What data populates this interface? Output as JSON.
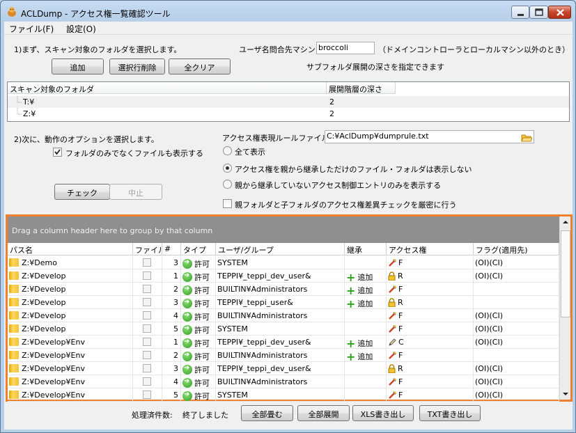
{
  "window": {
    "title": "ACLDump - アクセス権一覧確認ツール"
  },
  "menu": {
    "file": "ファイル(F)",
    "settings": "設定(O)"
  },
  "step1": {
    "instruction": "1)まず、スキャン対象のフォルダを選択します。",
    "user_machine_label": "ユーザ名問合先マシン:",
    "user_machine_value": "broccoli",
    "user_machine_hint": "（ドメインコントローラとローカルマシン以外のとき）",
    "add_button": "追加",
    "delete_selected_button": "選択行削除",
    "clear_all_button": "全クリア",
    "depth_hint": "サブフォルダ展開の深さを指定できます"
  },
  "folder_list": {
    "headers": [
      "スキャン対象のフォルダ",
      "展開階層の深さ"
    ],
    "rows": [
      {
        "folder": "T:¥",
        "depth": "2"
      },
      {
        "folder": "Z:¥",
        "depth": "2"
      }
    ]
  },
  "step2": {
    "instruction": "2)次に、動作のオプションを選択します。",
    "show_files_checkbox": "フォルダのみでなくファイルも表示する",
    "show_files_checked": true,
    "rule_file_label": "アクセス権表現ルールファイル:",
    "rule_file_value": "C:¥AclDump¥dumprule.txt",
    "radio_all": "全て表示",
    "radio_hide_inherited": "アクセス権を親から継承しただけのファイル・フォルダは表示しない",
    "radio_non_inherited_only": "親から継承していないアクセス制御エントリのみを表示する",
    "radio_selected": "radio_hide_inherited",
    "strict_check": "親フォルダと子フォルダのアクセス権差異チェックを厳密に行う",
    "strict_checked": false,
    "check_button": "チェック",
    "stop_button": "中止"
  },
  "grid": {
    "group_hint": "Drag a column header here to group by that column",
    "headers": [
      "パス名",
      "ファイル",
      "#",
      "タイプ",
      "ユーザ/グループ",
      "継承",
      "アクセス権",
      "フラグ(適用先)"
    ],
    "rows": [
      {
        "path": "Z:¥Demo",
        "num": "3",
        "type": "許可",
        "user": "SYSTEM",
        "inherit": "",
        "perm_icon": "tool",
        "perm": "F",
        "flags": "(OI)(CI)"
      },
      {
        "path": "Z:¥Develop",
        "num": "1",
        "type": "許可",
        "user": "TEPPI¥_teppi_dev_user&",
        "inherit": "追加",
        "perm_icon": "lock",
        "perm": "R",
        "flags": "(OI)(CI)"
      },
      {
        "path": "Z:¥Develop",
        "num": "2",
        "type": "許可",
        "user": "BUILTIN¥Administrators",
        "inherit": "追加",
        "perm_icon": "tool",
        "perm": "F",
        "flags": ""
      },
      {
        "path": "Z:¥Develop",
        "num": "3",
        "type": "許可",
        "user": "TEPPI¥_teppi_user&",
        "inherit": "追加",
        "perm_icon": "lock",
        "perm": "R",
        "flags": ""
      },
      {
        "path": "Z:¥Develop",
        "num": "4",
        "type": "許可",
        "user": "BUILTIN¥Administrators",
        "inherit": "",
        "perm_icon": "tool",
        "perm": "F",
        "flags": "(OI)(CI)"
      },
      {
        "path": "Z:¥Develop",
        "num": "5",
        "type": "許可",
        "user": "SYSTEM",
        "inherit": "",
        "perm_icon": "tool",
        "perm": "F",
        "flags": "(OI)(CI)"
      },
      {
        "path": "Z:¥Develop¥Env",
        "num": "1",
        "type": "許可",
        "user": "TEPPI¥_teppi_dev_user&",
        "inherit": "追加",
        "perm_icon": "pencil",
        "perm": "C",
        "flags": "(OI)(CI)"
      },
      {
        "path": "Z:¥Develop¥Env",
        "num": "2",
        "type": "許可",
        "user": "BUILTIN¥Administrators",
        "inherit": "追加",
        "perm_icon": "tool",
        "perm": "F",
        "flags": ""
      },
      {
        "path": "Z:¥Develop¥Env",
        "num": "3",
        "type": "許可",
        "user": "TEPPI¥_teppi_dev_user&",
        "inherit": "",
        "perm_icon": "lock",
        "perm": "R",
        "flags": "(OI)(CI)"
      },
      {
        "path": "Z:¥Develop¥Env",
        "num": "4",
        "type": "許可",
        "user": "BUILTIN¥Administrators",
        "inherit": "",
        "perm_icon": "tool",
        "perm": "F",
        "flags": "(OI)(CI)"
      },
      {
        "path": "Z:¥Develop¥Env",
        "num": "5",
        "type": "許可",
        "user": "SYSTEM",
        "inherit": "",
        "perm_icon": "tool",
        "perm": "F",
        "flags": "(OI)(CI)"
      }
    ]
  },
  "footer": {
    "processed_label": "処理済件数:",
    "status": "終了しました",
    "collapse_all": "全部畳む",
    "expand_all": "全部展開",
    "export_xls": "XLS書き出し",
    "export_txt": "TXT書き出し"
  },
  "colors": {
    "highlight_border": "#f08030",
    "group_panel": "#8f8f8f"
  }
}
